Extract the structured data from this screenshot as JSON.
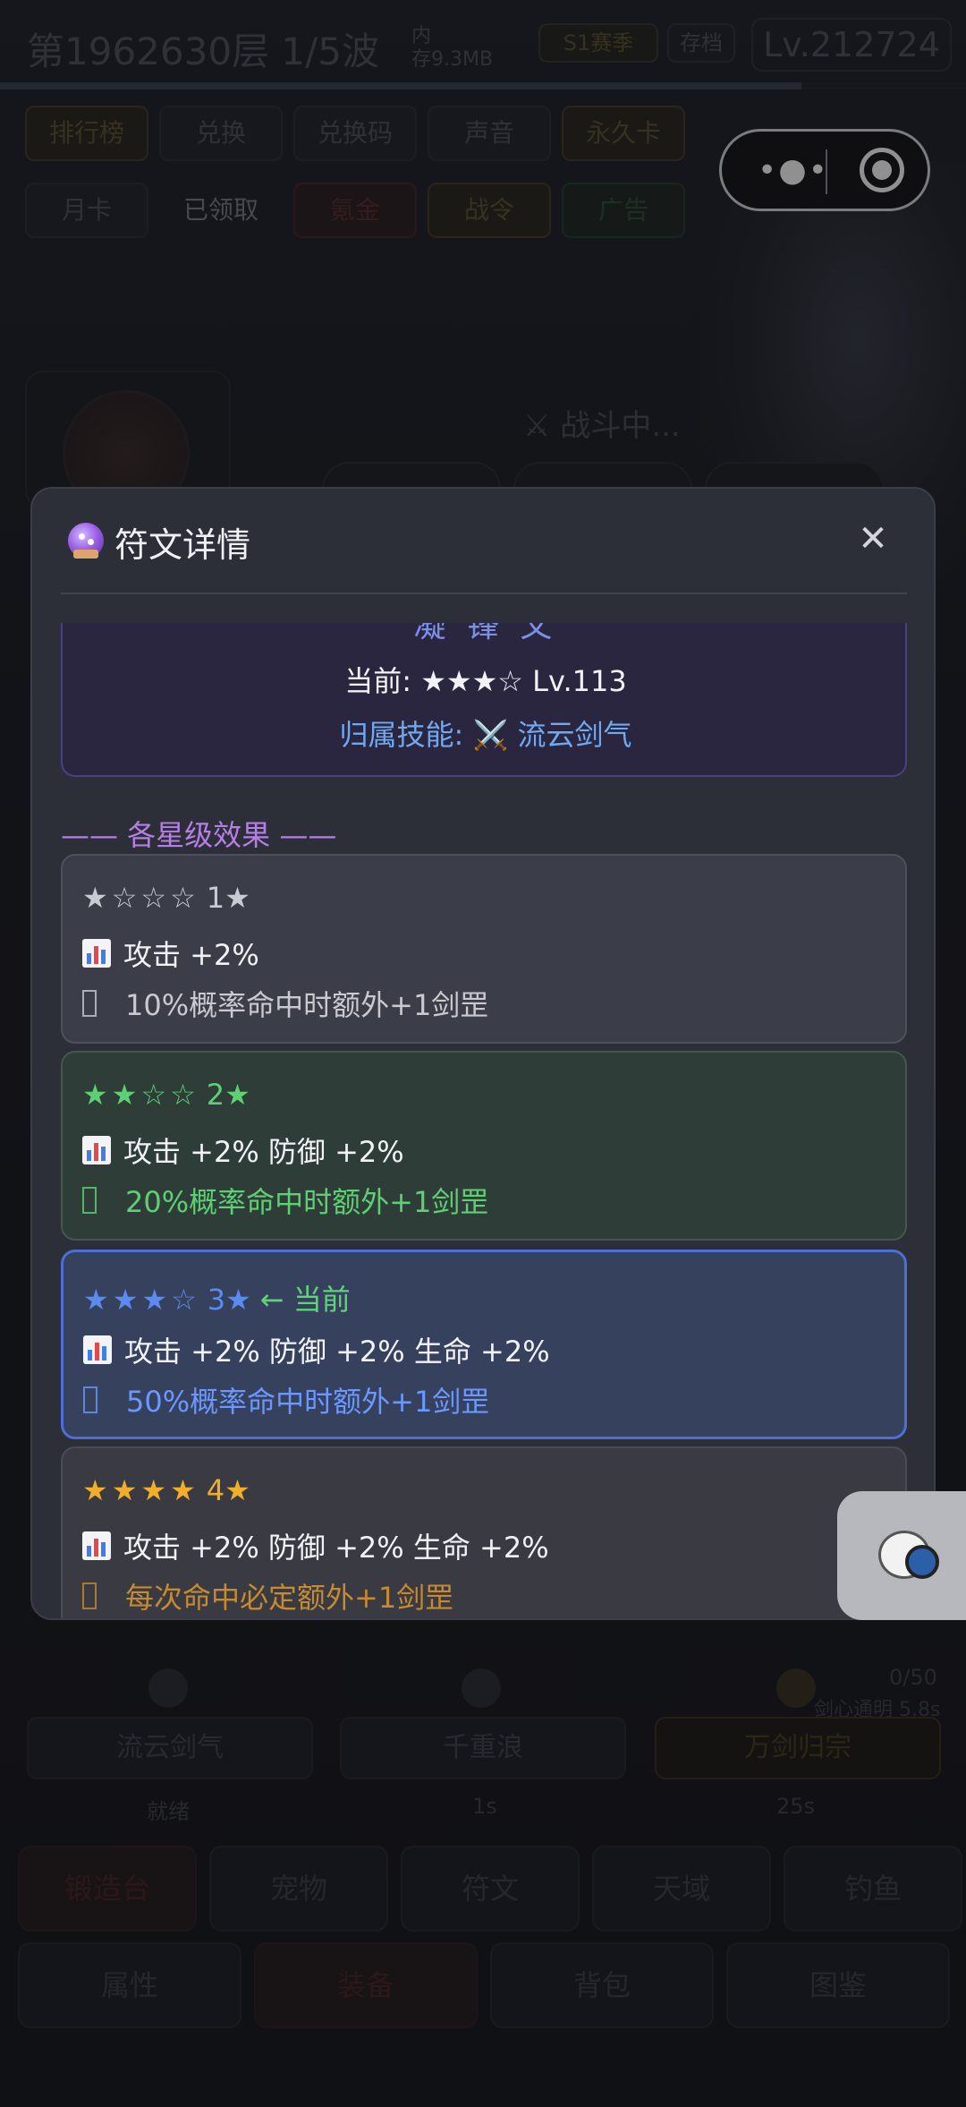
{
  "background": {
    "floor_text": "第1962630层  1/5波",
    "memory_label": "内",
    "memory_value": "存9.3MB",
    "season_badge": "S1赛季",
    "save_badge": "存档",
    "level": "Lv.212724",
    "menu_row1": [
      "排行榜",
      "兑换",
      "兑换码",
      "声音",
      "永久卡"
    ],
    "menu_row2": [
      "月卡",
      "已领取",
      "氪金",
      "战令",
      "广告"
    ],
    "battle_status": "⚔ 战斗中...",
    "skills": [
      {
        "name": "流云剑气",
        "status": "就绪"
      },
      {
        "name": "千重浪",
        "status": "1s"
      },
      {
        "name": "万剑归宗",
        "status": "25s"
      }
    ],
    "sword_heart": "0/50",
    "sword_heart_note": "剑心通明 5.8s",
    "nav_row1": [
      "锻造台",
      "宠物",
      "符文",
      "天域",
      "钓鱼"
    ],
    "nav_row2": [
      "属性",
      "装备",
      "背包",
      "图鉴"
    ]
  },
  "capsule": {
    "more_icon": "more-dots-icon",
    "close_icon": "target-icon"
  },
  "modal": {
    "title": "符文详情",
    "title_icon": "crystal-ball-icon",
    "close_label": "✕",
    "rune_name": "凝 锋 文",
    "current_label": "当前: ★★★☆  Lv.113",
    "skill_label": "归属技能:",
    "skill_icon": "⚔️",
    "skill_name": "流云剑气",
    "section_title": "—— 各星级效果 ——",
    "levels": [
      {
        "stars": "★☆☆☆",
        "label": "1★",
        "stats": "攻击 +2%",
        "effect": "10%概率命中时额外+1剑罡",
        "current": false
      },
      {
        "stars": "★★☆☆",
        "label": "2★",
        "stats": "攻击 +2%  防御 +2%",
        "effect": "20%概率命中时额外+1剑罡",
        "current": false
      },
      {
        "stars": "★★★☆",
        "label": "3★",
        "stats": "攻击 +2%  防御 +2%  生命 +2%",
        "effect": "50%概率命中时额外+1剑罡",
        "current": true,
        "current_tag": "← 当前"
      },
      {
        "stars": "★★★★",
        "label": "4★",
        "stats": "攻击 +2%  防御 +2%  生命 +2%",
        "effect": "每次命中必定额外+1剑罡",
        "current": false
      }
    ]
  },
  "colors": {
    "accent_purple": "#b67ee6",
    "current_blue": "#5b8af0",
    "green": "#5fcf74",
    "gold": "#f0ae2a"
  }
}
